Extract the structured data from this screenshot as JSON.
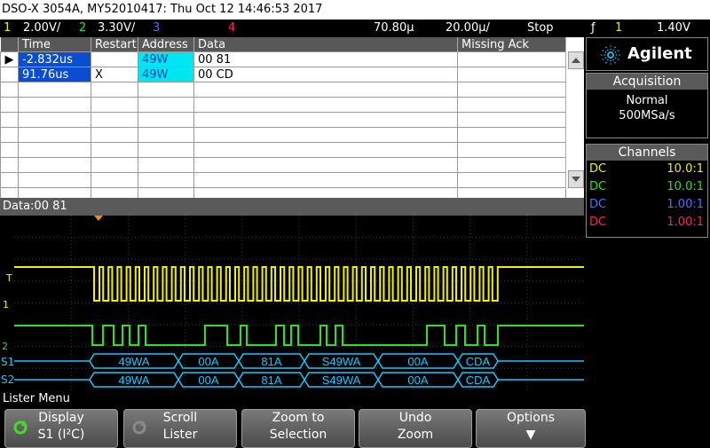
{
  "titlebar": {
    "text": "DSO-X 3054A, MY52010417: Thu Oct 12 14:46:53 2017"
  },
  "status": {
    "ch1_num": "1",
    "ch1_scale": "2.00V/",
    "ch2_num": "2",
    "ch2_scale": "3.30V/",
    "ch3_num": "3",
    "ch4_num": "4",
    "time_delay": "70.80µ",
    "time_scale": "20.00µ/",
    "run_state": "Stop",
    "trigger_icon": "ƒ",
    "trigger_ch": "1",
    "trigger_level": "1.40V"
  },
  "lister": {
    "headers": [
      "Time",
      "Restart",
      "Address",
      "Data",
      "Missing Ack"
    ],
    "rows": [
      {
        "time": "-2.832us",
        "restart": "",
        "address": "49W",
        "data": "00  81",
        "missing": ""
      },
      {
        "time": "91.76us",
        "restart": "X",
        "address": "49W",
        "data": "00  CD",
        "missing": ""
      }
    ],
    "selected_arrow": "▶",
    "empty_rows": 8
  },
  "data_line": "Data:00 81",
  "decode": {
    "s1_label": "S1",
    "s2_label": "S2",
    "bus1": [
      "49WA",
      "00A",
      "81A",
      "S49WA",
      "00A",
      "CDA"
    ],
    "bus2": [
      "49WA",
      "00A",
      "81A",
      "S49WA",
      "00A",
      "CDA"
    ]
  },
  "markers": {
    "t": "T",
    "ch1": "1",
    "ch2": "2"
  },
  "panel": {
    "logo": "Agilent",
    "acq_title": "Acquisition",
    "acq_mode": "Normal",
    "acq_rate": "500MSa/s",
    "channels_title": "Channels",
    "channels": [
      {
        "coupling": "DC",
        "ratio": "10.0:1",
        "color": "#f0f000"
      },
      {
        "coupling": "DC",
        "ratio": "10.0:1",
        "color": "#30e020"
      },
      {
        "coupling": "DC",
        "ratio": "1.00:1",
        "color": "#5070ff"
      },
      {
        "coupling": "DC",
        "ratio": "1.00:1",
        "color": "#ff2060"
      }
    ]
  },
  "menu": {
    "title": "Lister Menu",
    "buttons": [
      {
        "line1": "Display",
        "line2": "S1 (I²C)"
      },
      {
        "line1": "Scroll",
        "line2": "Lister"
      },
      {
        "line1": "Zoom to",
        "line2": "Selection"
      },
      {
        "line1": "Undo",
        "line2": "Zoom"
      },
      {
        "line1": "Options",
        "line2": "▼"
      }
    ]
  },
  "colors": {
    "ch1": "#f0f000",
    "ch2": "#30e020",
    "ch3": "#5070ff",
    "ch4": "#ff2060",
    "decode": "#19c6ff"
  }
}
